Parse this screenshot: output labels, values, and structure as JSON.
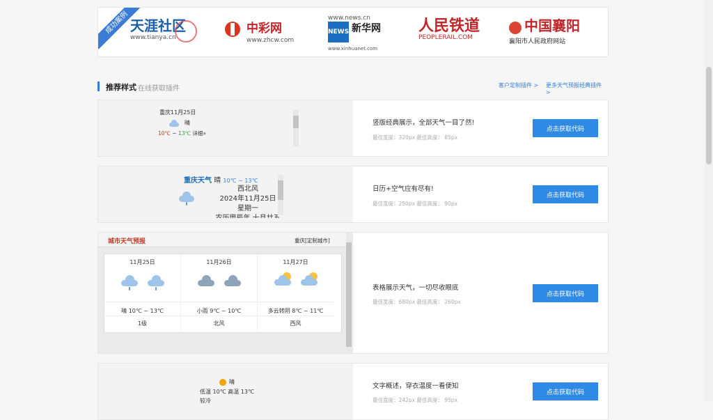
{
  "partners": {
    "badge": "成功案例",
    "tianya": {
      "name": "天涯社区",
      "url": "www.tianya.cn"
    },
    "zhcw": {
      "name": "中彩网",
      "url": "www.zhcw.com"
    },
    "xinhua": {
      "name": "新华网",
      "top": "www.news.cn",
      "mark": "NEWS",
      "url": "www.xinhuanet.com"
    },
    "peoplerail": {
      "name": "人民铁道",
      "url": "PEOPLERAIL.COM"
    },
    "xiangyang": {
      "name": "中国襄阳",
      "sub": "襄阳市人民政府网站"
    }
  },
  "section": {
    "title": "推荐样式",
    "subtitle": "在线获取插件",
    "link_custom": "客户定制插件 >",
    "link_more": "更多天气预报经典插件 >"
  },
  "cards": [
    {
      "headline": "竖版经典展示，全部天气一目了然!",
      "meta": "最佳宽度：320px 最佳高度： 85px",
      "button": "点击获取代码",
      "widget": {
        "date": "重庆11月25日",
        "weather": "晴",
        "temp_low": "10℃",
        "tilde": "~",
        "temp_high": "13℃",
        "detail": "详细»"
      }
    },
    {
      "headline": "日历+空气应有尽有!",
      "meta": "最佳宽度：250px 最佳高度： 90px",
      "button": "点击获取代码",
      "widget": {
        "city": "重庆天气",
        "weather": "晴",
        "temp": "10℃ ~ 13℃",
        "wind": "西北风",
        "date": "2024年11月25日",
        "weekday": "星期一",
        "cut": "农历甲辰年 十月廿五"
      }
    },
    {
      "headline": "表格展示天气，一切尽收眼底",
      "meta": "最佳宽度：680px 最佳高度： 260px",
      "button": "点击获取代码",
      "widget": {
        "title": "城市天气预报",
        "city": "重庆",
        "customize": "[定制城市]",
        "days": [
          {
            "date": "11月25日",
            "desc": "晴 10℃ ~ 13℃",
            "wind": "1级"
          },
          {
            "date": "11月26日",
            "desc": "小雨 9℃ ~ 10℃",
            "wind": "北风"
          },
          {
            "date": "11月27日",
            "desc": "多云转阴 8℃ ~ 11℃",
            "wind": "西风"
          }
        ]
      }
    },
    {
      "headline": "文字概述，穿衣温度一看便知",
      "meta": "最佳宽度：242px 最佳高度： 95px",
      "button": "点击获取代码",
      "widget": {
        "weather": "晴",
        "temps": "低温 10℃ 高温 13℃",
        "advice": "较冷"
      }
    }
  ],
  "colors": {
    "accent": "#2f8ae6",
    "red": "#c0392b",
    "green": "#3aa03a"
  }
}
